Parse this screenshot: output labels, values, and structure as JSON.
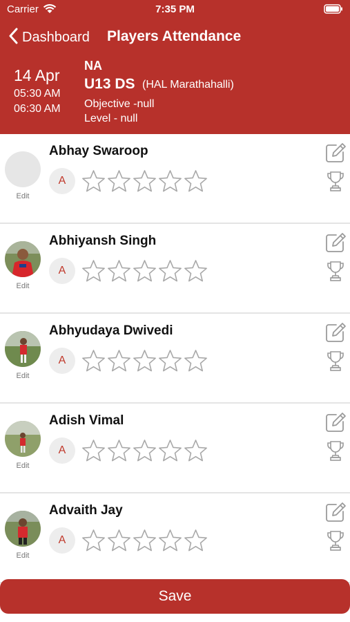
{
  "status_bar": {
    "carrier": "Carrier",
    "time": "7:35 PM",
    "icons": [
      "wifi-icon",
      "battery-icon"
    ]
  },
  "nav": {
    "back_label": "Dashboard",
    "title": "Players Attendance"
  },
  "session": {
    "date": "14 Apr",
    "start_time": "05:30 AM",
    "end_time": "06:30 AM",
    "code": "NA",
    "team": "U13 DS",
    "venue": "(HAL Marathahalli)",
    "objective": "Objective -null",
    "level": "Level - null"
  },
  "colors": {
    "brand": "#b7312b",
    "badge_text": "#c0392b",
    "star_outline": "#a8a8a8"
  },
  "players": [
    {
      "name": "Abhay Swaroop",
      "edit_label": "Edit",
      "attendance": "A",
      "rating": 0,
      "has_photo": false
    },
    {
      "name": "Abhiyansh Singh",
      "edit_label": "Edit",
      "attendance": "A",
      "rating": 0,
      "has_photo": true
    },
    {
      "name": "Abhyudaya Dwivedi",
      "edit_label": "Edit",
      "attendance": "A",
      "rating": 0,
      "has_photo": true
    },
    {
      "name": "Adish Vimal",
      "edit_label": "Edit",
      "attendance": "A",
      "rating": 0,
      "has_photo": true
    },
    {
      "name": "Advaith Jay",
      "edit_label": "Edit",
      "attendance": "A",
      "rating": 0,
      "has_photo": true
    }
  ],
  "save_label": "Save"
}
